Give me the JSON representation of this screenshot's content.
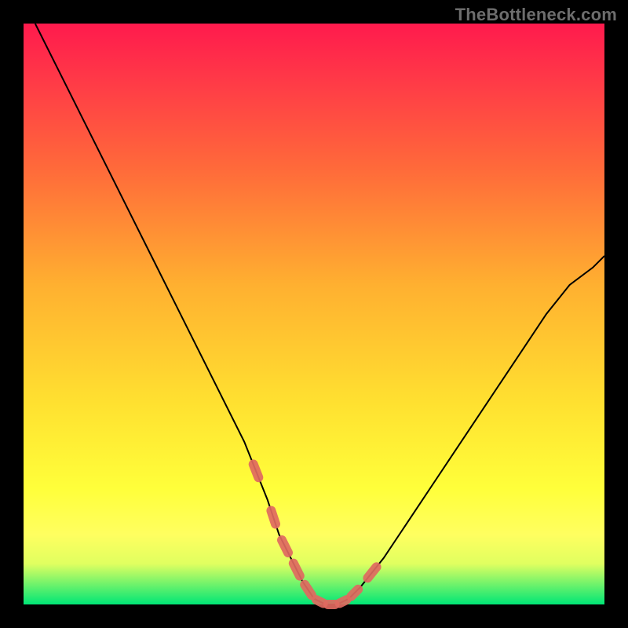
{
  "watermark": "TheBottleneck.com",
  "chart_data": {
    "type": "line",
    "title": "",
    "xlabel": "",
    "ylabel": "",
    "xlim": [
      0,
      100
    ],
    "ylim": [
      0,
      100
    ],
    "grid": false,
    "legend": false,
    "series": [
      {
        "name": "bottleneck-curve",
        "x": [
          2,
          6,
          10,
          14,
          18,
          22,
          26,
          30,
          34,
          38,
          42,
          44,
          46,
          48,
          50,
          52,
          54,
          56,
          58,
          62,
          66,
          70,
          74,
          78,
          82,
          86,
          90,
          94,
          98,
          100
        ],
        "values": [
          100,
          92,
          84,
          76,
          68,
          60,
          52,
          44,
          36,
          28,
          18,
          12,
          8,
          4,
          1,
          0,
          0,
          1,
          3,
          8,
          14,
          20,
          26,
          32,
          38,
          44,
          50,
          55,
          58,
          60
        ]
      }
    ],
    "highlight_range_x": [
      38,
      62
    ],
    "highlight_style": "dashed-coral",
    "colors": {
      "curve": "#000000",
      "highlight": "#e06a60",
      "background_top": "#ff1a4d",
      "background_bottom": "#00e676"
    }
  }
}
